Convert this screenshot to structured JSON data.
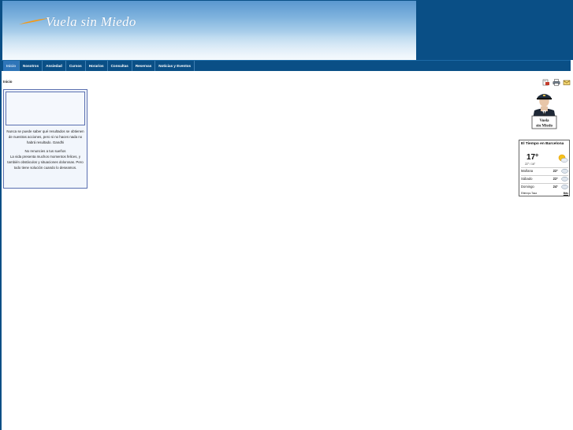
{
  "header": {
    "title": "Vuela sin Miedo"
  },
  "nav": {
    "items": [
      {
        "label": "Inicio",
        "active": true
      },
      {
        "label": "Nosotros",
        "active": false
      },
      {
        "label": "Ansiedad",
        "active": false
      },
      {
        "label": "Cursos",
        "active": false
      },
      {
        "label": "Horarios",
        "active": false
      },
      {
        "label": "Consultas",
        "active": false
      },
      {
        "label": "Reservas",
        "active": false
      },
      {
        "label": "Noticias y Eventos",
        "active": false
      }
    ]
  },
  "breadcrumb": "Inicio",
  "tools": {
    "icons": [
      "pdf-icon",
      "print-icon",
      "email-icon"
    ]
  },
  "quote": {
    "text1": "Nunca se puede saber qué resultados se obtienen de nuestras acciones, pero si no haces nada no habrá resultado. Gandhi",
    "text2": "No renuncies a tus sueños",
    "text3": "La vida presenta muchos momentos felices, y también obstáculos y situaciones dolorosas. Pero todo tiene solución cuando lo deseamos."
  },
  "pilot": {
    "sign_line1": "Vuela",
    "sign_line2": "sin Miedo"
  },
  "weather": {
    "title": "El Tiempo en Barcelona",
    "current_temp": "17°",
    "range": "22° / 16°",
    "forecast": [
      {
        "day": "Mañana",
        "temp": "22°"
      },
      {
        "day": "Sábado",
        "temp": "22°"
      },
      {
        "day": "Domingo",
        "temp": "24°"
      }
    ],
    "footer_left": "Eltiempo.Tasa",
    "footer_right": "Más"
  },
  "colors": {
    "primary": "#0a4f86",
    "nav_active": "#2f75b8",
    "box_border": "#5a6fb0",
    "box_bg": "#f2f6fc"
  }
}
